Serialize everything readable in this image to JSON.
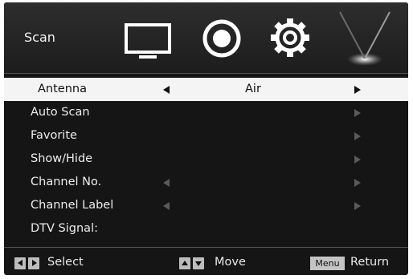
{
  "header": {
    "title": "Scan",
    "icons": [
      "tv-icon",
      "audio-icon",
      "settings-gear-icon",
      "antenna-icon"
    ]
  },
  "menu": {
    "items": [
      {
        "label": "Antenna",
        "value": "Air",
        "selected": true,
        "left_arrow": true,
        "right_arrow": true
      },
      {
        "label": "Auto Scan",
        "value": "",
        "selected": false,
        "left_arrow": false,
        "right_arrow": true
      },
      {
        "label": "Favorite",
        "value": "",
        "selected": false,
        "left_arrow": false,
        "right_arrow": true
      },
      {
        "label": "Show/Hide",
        "value": "",
        "selected": false,
        "left_arrow": false,
        "right_arrow": true
      },
      {
        "label": "Channel No.",
        "value": "",
        "selected": false,
        "left_arrow": true,
        "right_arrow": true
      },
      {
        "label": "Channel Label",
        "value": "",
        "selected": false,
        "left_arrow": true,
        "right_arrow": true
      },
      {
        "label": "DTV Signal:",
        "value": "",
        "selected": false,
        "left_arrow": false,
        "right_arrow": false
      }
    ]
  },
  "footer": {
    "select_label": "Select",
    "move_label": "Move",
    "menu_key_label": "Menu",
    "return_label": "Return"
  },
  "colors": {
    "background": "#151515",
    "highlight": "#f4f4f4",
    "text": "#ededed",
    "arrow": "#5a5a5a"
  }
}
